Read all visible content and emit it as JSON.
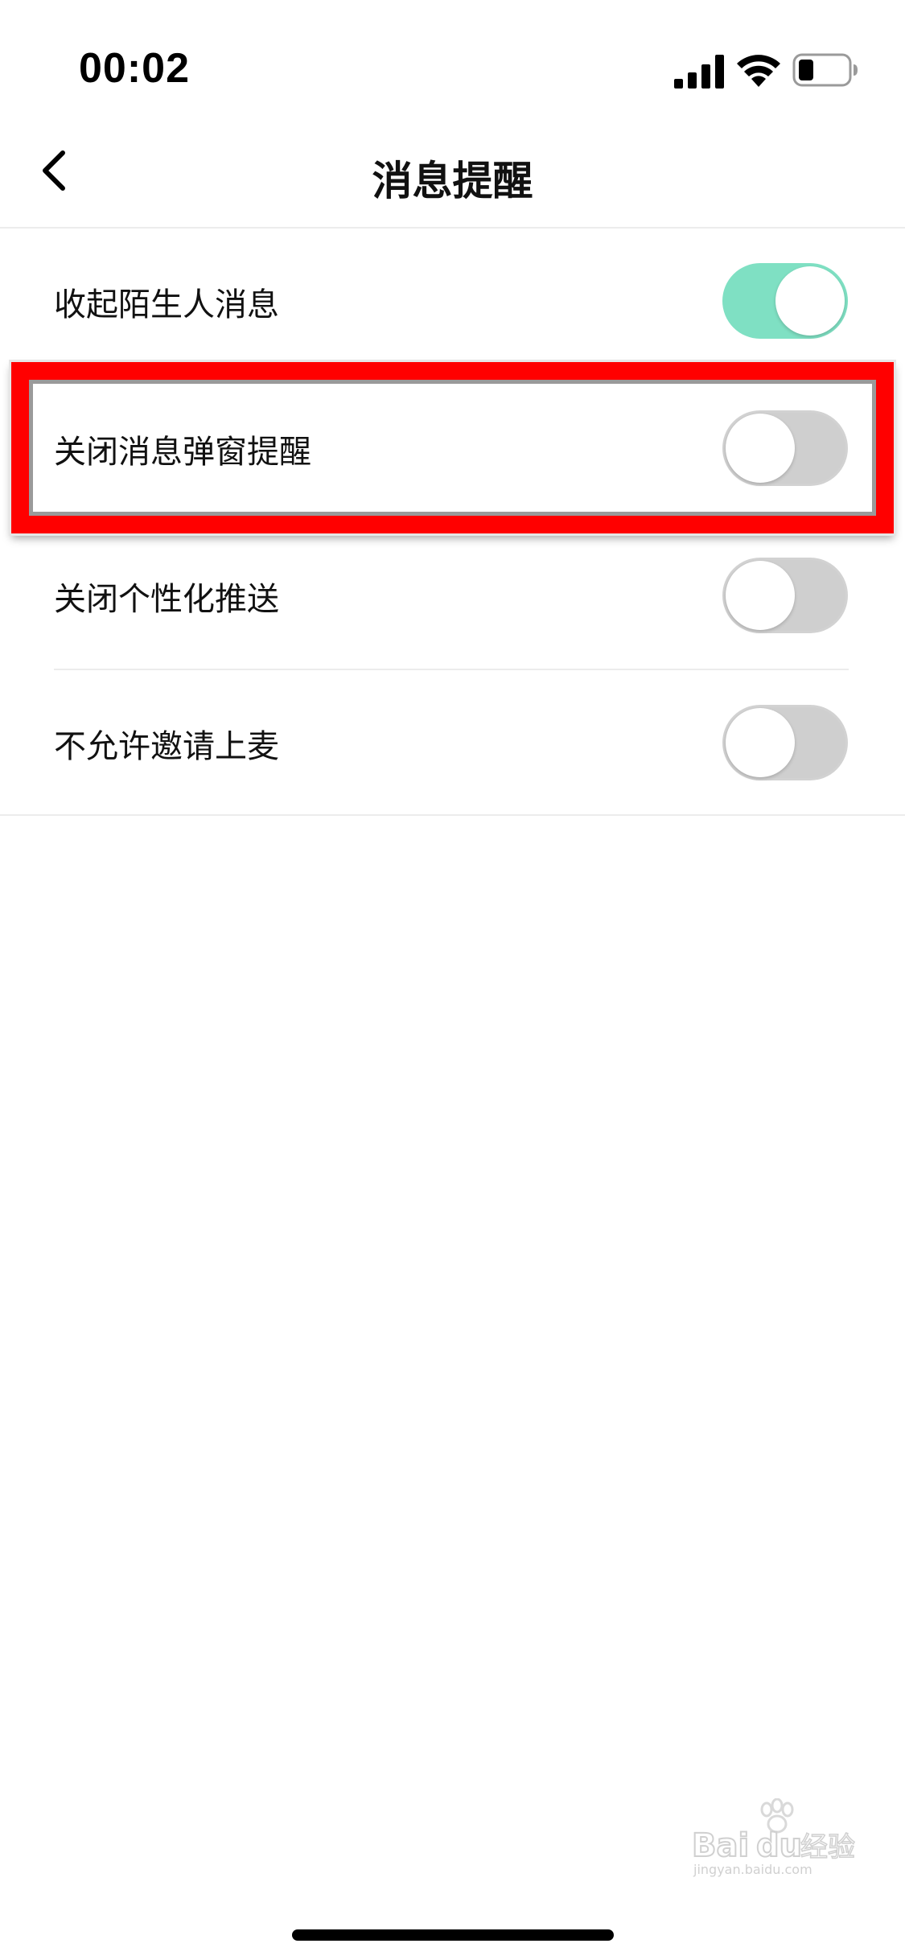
{
  "status_bar": {
    "time": "00:02",
    "icons": [
      "signal-icon",
      "wifi-icon",
      "battery-icon"
    ]
  },
  "nav": {
    "title": "消息提醒",
    "back_icon": "chevron-left-icon"
  },
  "settings": [
    {
      "label": "收起陌生人消息",
      "enabled": true
    },
    {
      "label": "关闭消息弹窗提醒",
      "enabled": false
    },
    {
      "label": "关闭个性化推送",
      "enabled": false
    },
    {
      "label": "不允许邀请上麦",
      "enabled": false
    }
  ],
  "colors": {
    "toggle_on": "#7fe0c3",
    "toggle_off": "#cfcfcf",
    "highlight": "#ff0000"
  },
  "watermark": {
    "text": "Baidu经验",
    "subtext": "jingyan.baidu.com"
  }
}
